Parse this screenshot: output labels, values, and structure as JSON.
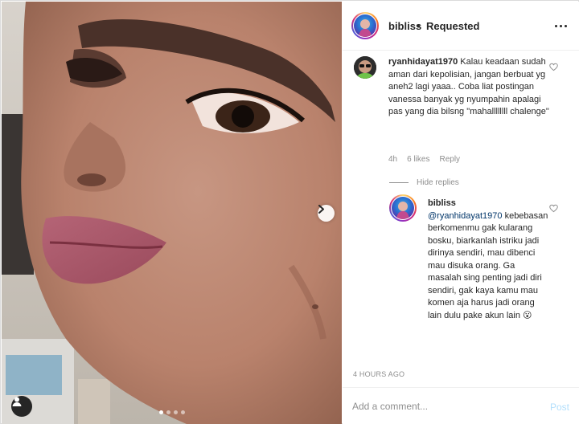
{
  "post": {
    "username": "bibliss",
    "separator": "•",
    "follow_status": "Requested",
    "more_icon": "more-horizontal-icon",
    "carousel": {
      "slide_count": 4,
      "active_index": 0
    }
  },
  "comments": {
    "main": {
      "username": "ryanhidayat1970",
      "text": " Kalau keadaan sudah aman dari kepolisian, jangan berbuat yg aneh2 lagi yaaa.. Coba liat postingan vanessa banyak yg nyumpahin apalagi pas yang dia bilsng \"mahallllllll chalenge\"",
      "time": "4h",
      "likes": "6 likes",
      "reply_label": "Reply"
    },
    "hide_replies_label": "Hide replies",
    "reply": {
      "username": "bibliss",
      "mention": "@ryanhidayat1970",
      "text": " kebebasan berkomenmu gak kularang bosku, biarkanlah istriku jadi dirinya sendiri, mau dibenci mau disuka orang. Ga masalah sing penting jadi diri sendiri, gak kaya kamu mau komen aja harus jadi orang lain dulu pake akun lain 😮"
    }
  },
  "timestamp": "4 HOURS AGO",
  "composer": {
    "placeholder": "Add a comment...",
    "post_label": "Post"
  },
  "colors": {
    "link": "#003569",
    "muted": "#8e8e8e",
    "post_disabled": "#b2dffc"
  }
}
